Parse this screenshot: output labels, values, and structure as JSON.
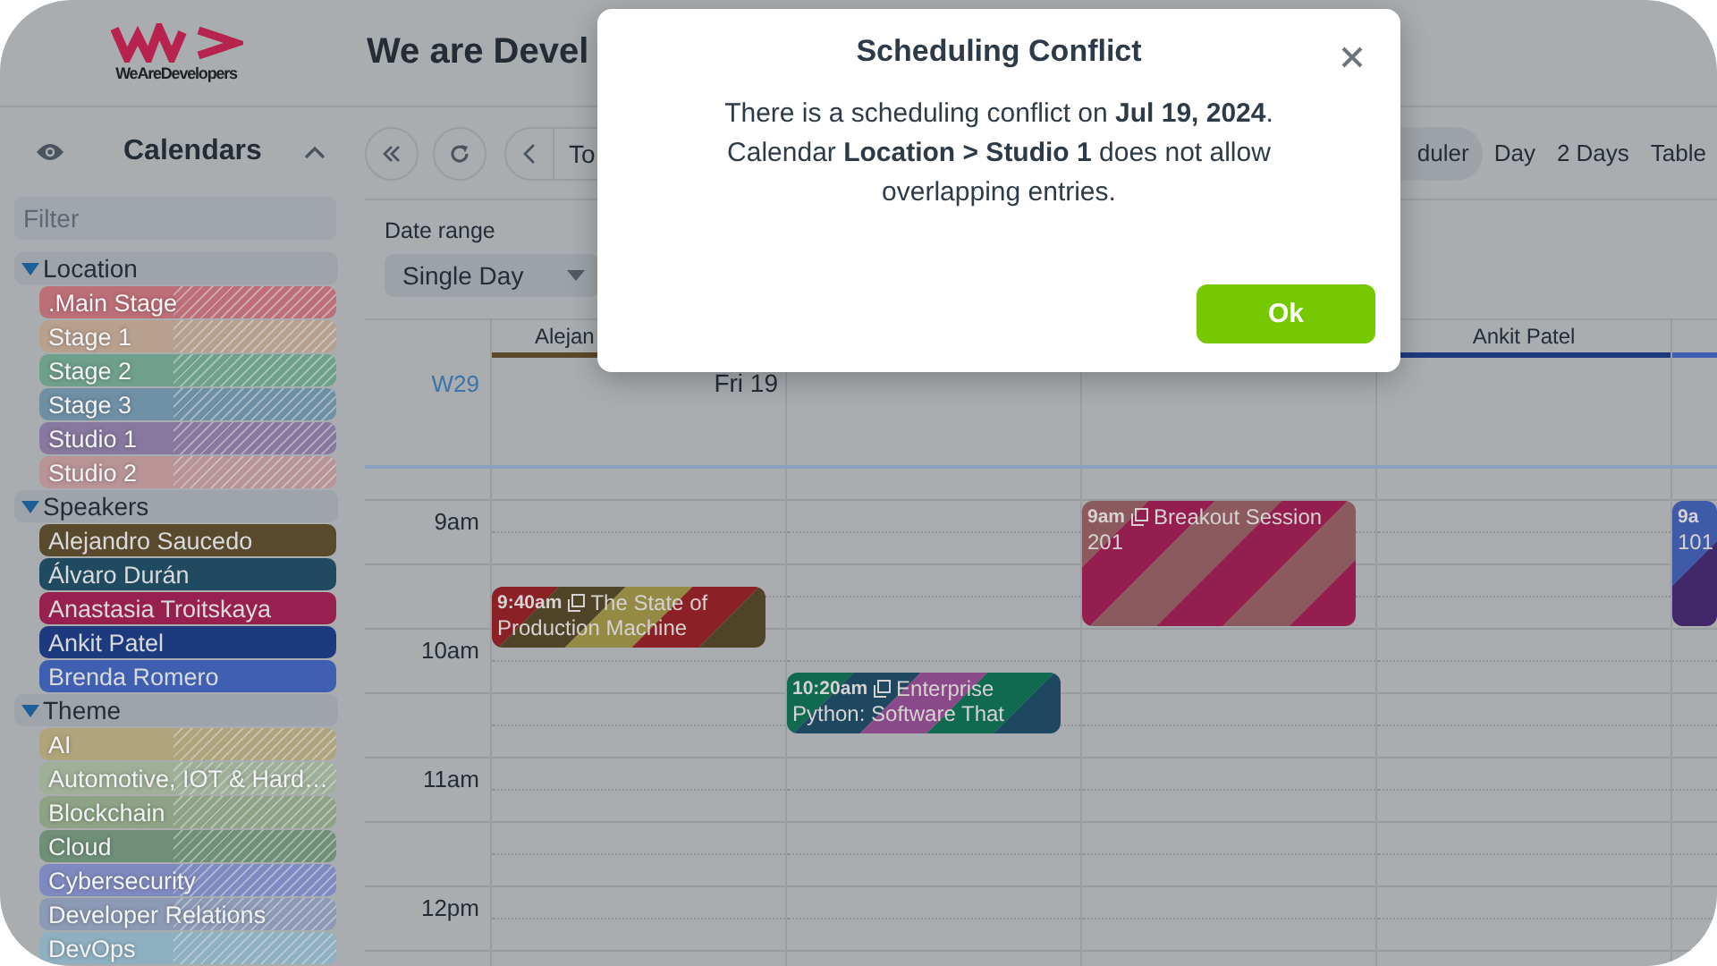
{
  "header": {
    "logo_text": "WeAreDevelopers",
    "title": "We are Devel"
  },
  "sidebar": {
    "title": "Calendars",
    "filter": {
      "placeholder": "Filter"
    },
    "groups": [
      {
        "label": "Location",
        "expanded": true,
        "children": [
          {
            "label": ".Main Stage",
            "color": "#bd6f77",
            "visible": false
          },
          {
            "label": "Stage 1",
            "color": "#b8a08f",
            "visible": false
          },
          {
            "label": "Stage 2",
            "color": "#6fa08c",
            "visible": false
          },
          {
            "label": "Stage 3",
            "color": "#6f8fa5",
            "visible": false
          },
          {
            "label": "Studio 1",
            "color": "#86789e",
            "visible": false
          },
          {
            "label": "Studio 2",
            "color": "#b89496",
            "visible": false
          }
        ]
      },
      {
        "label": "Speakers",
        "expanded": true,
        "children": [
          {
            "label": "Alejandro Saucedo",
            "color": "#5a4a2d",
            "visible": true
          },
          {
            "label": "Álvaro Durán",
            "color": "#1f4a60",
            "visible": true
          },
          {
            "label": "Anastasia Troitskaya",
            "color": "#98204f",
            "visible": true
          },
          {
            "label": "Ankit Patel",
            "color": "#1e3a7e",
            "visible": true
          },
          {
            "label": "Brenda Romero",
            "color": "#3f5fb0",
            "visible": true
          }
        ]
      },
      {
        "label": "Theme",
        "expanded": true,
        "children": [
          {
            "label": "AI",
            "color": "#b0a47c",
            "visible": false
          },
          {
            "label": "Automotive, IOT & Hard…",
            "color": "#a0b098",
            "visible": false
          },
          {
            "label": "Blockchain",
            "color": "#8ea386",
            "visible": false
          },
          {
            "label": "Cloud",
            "color": "#6f8f78",
            "visible": false
          },
          {
            "label": "Cybersecurity",
            "color": "#7f8ac0",
            "visible": false
          },
          {
            "label": "Developer Relations",
            "color": "#8d9ab5",
            "visible": false
          },
          {
            "label": "DevOps",
            "color": "#8fb0c0",
            "visible": false
          }
        ]
      }
    ]
  },
  "toolbar": {
    "today": "To",
    "views": [
      {
        "label": "duler",
        "selected": true
      },
      {
        "label": "Day",
        "selected": false
      },
      {
        "label": "2 Days",
        "selected": false
      },
      {
        "label": "Table",
        "selected": false
      }
    ]
  },
  "date_range": {
    "label": "Date range",
    "value": "Single Day"
  },
  "calendar": {
    "week": "W29",
    "day": "Fri 19",
    "times": [
      "9am",
      "10am",
      "11am",
      "12pm"
    ],
    "columns": [
      {
        "header": "Alejan",
        "color": "#5a4a2d",
        "events": [
          {
            "time": "9:40am",
            "title": "The State of",
            "title_more": [
              "Production Machine"
            ],
            "linked": true,
            "kind": "short",
            "stripes": [
              {
                "color": "#8b2127"
              },
              {
                "color": "#504428"
              },
              {
                "color": "#958a44"
              },
              {
                "color": "#8b2127"
              },
              {
                "color": "#504428"
              }
            ]
          }
        ]
      },
      {
        "events": [
          {
            "time": "10:20am",
            "title": "Enterprise",
            "title_more": [
              "Python: Software That"
            ],
            "linked": true,
            "kind": "short",
            "stripes": [
              {
                "color": "#0f6a50"
              },
              {
                "color": "#1e4860"
              },
              {
                "color": "#8a4a8a"
              },
              {
                "color": "#0f6a50"
              },
              {
                "color": "#1e4860"
              }
            ]
          }
        ]
      },
      {
        "events": [
          {
            "time": "9am",
            "title": "Breakout Session",
            "title_more": [
              "201"
            ],
            "linked": true,
            "kind": "hour",
            "stripes": [
              {
                "color": "#8a5a5e"
              },
              {
                "color": "#941f4f"
              },
              {
                "color": "#8a5a5e"
              },
              {
                "color": "#941f4f"
              },
              {
                "color": "#8a5a5e"
              },
              {
                "color": "#941f4f"
              }
            ]
          }
        ]
      },
      {
        "header": "Ankit Patel",
        "color": "#1e3a7e"
      },
      {
        "color": "#3f5fb0",
        "events": [
          {
            "time": "9a",
            "title_more": [
              "101"
            ],
            "linked": false,
            "kind": "hour",
            "stripes": [
              {
                "color": "#3f5ba8"
              },
              {
                "color": "#40286a"
              }
            ]
          }
        ]
      }
    ]
  },
  "dialog": {
    "title": "Scheduling Conflict",
    "message": [
      "There is a scheduling conflict on **Jul 19, 2024**.",
      "Calendar **Location > Studio 1** does not allow overlapping entries."
    ],
    "button": "Ok"
  }
}
